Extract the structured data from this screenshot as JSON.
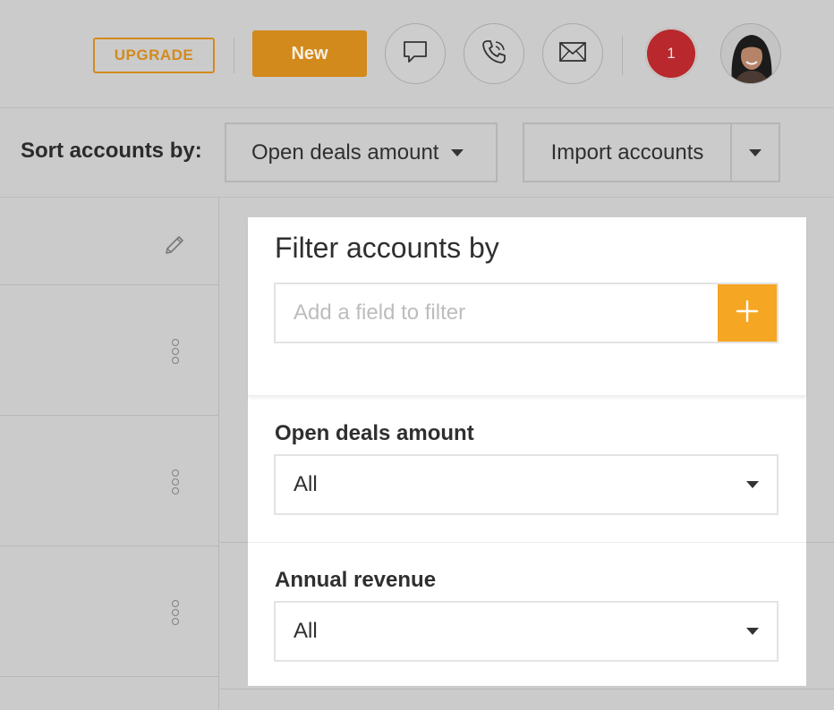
{
  "header": {
    "upgrade_label": "UPGRADE",
    "new_label": "New",
    "notification_count": "1",
    "icons": [
      "chat-icon",
      "phone-icon",
      "mail-icon"
    ]
  },
  "sortbar": {
    "label": "Sort accounts by:",
    "selected": "Open deals amount",
    "import_label": "Import accounts"
  },
  "filter_panel": {
    "title": "Filter accounts by",
    "input_placeholder": "Add a field to filter",
    "fields": [
      {
        "label": "Open deals amount",
        "value": "All"
      },
      {
        "label": "Annual revenue",
        "value": "All"
      }
    ]
  },
  "colors": {
    "accent": "#d38a1c",
    "add_button": "#f5a623",
    "notification": "#b8282c",
    "overlay_bg": "#cbcbcb"
  }
}
